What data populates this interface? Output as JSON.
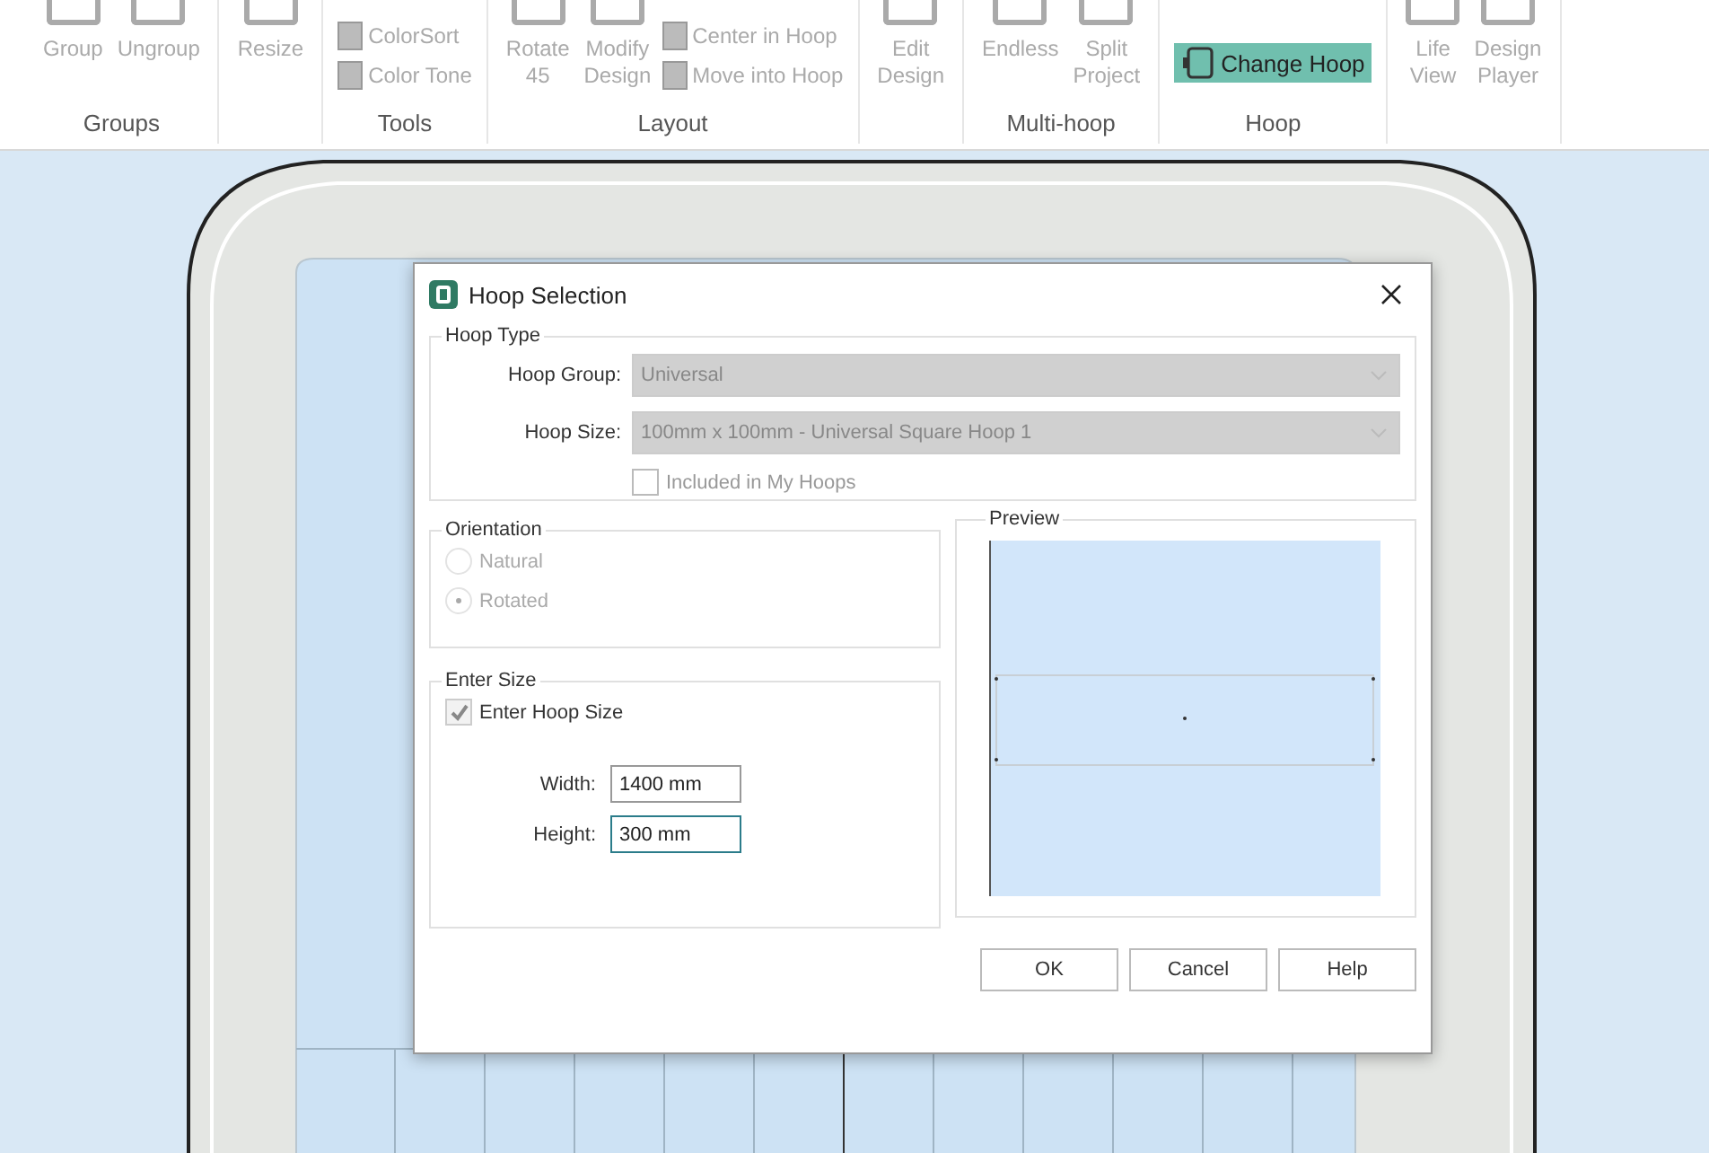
{
  "ribbon": {
    "groups": [
      {
        "label": "Groups",
        "items": [
          {
            "kind": "large",
            "label": "Group",
            "disabled": true,
            "selected": false
          },
          {
            "kind": "large",
            "label": "Ungroup",
            "disabled": true,
            "selected": false
          }
        ]
      },
      {
        "items": [
          {
            "kind": "large",
            "label": "Resize",
            "disabled": true,
            "selected": false
          }
        ]
      },
      {
        "label": "Tools",
        "items": [
          {
            "kind": "stack",
            "buttons": [
              {
                "label": "ColorSort",
                "disabled": true,
                "selected": false
              },
              {
                "label": "Color Tone",
                "disabled": true,
                "selected": false
              }
            ]
          }
        ]
      },
      {
        "label": "Layout",
        "items": [
          {
            "kind": "large",
            "label": "Rotate 45",
            "disabled": true,
            "selected": false
          },
          {
            "kind": "large",
            "label": "Modify Design",
            "disabled": true,
            "selected": false
          },
          {
            "kind": "stack",
            "buttons": [
              {
                "label": "Center in Hoop",
                "disabled": true,
                "selected": false
              },
              {
                "label": "Move into Hoop",
                "disabled": true,
                "selected": false
              }
            ]
          }
        ]
      },
      {
        "items": [
          {
            "kind": "large",
            "label": "Edit Design",
            "disabled": true,
            "selected": false
          }
        ]
      },
      {
        "label": "Multi-hoop",
        "items": [
          {
            "kind": "large",
            "label": "Endless",
            "disabled": true,
            "selected": false
          },
          {
            "kind": "large",
            "label": "Split Project",
            "disabled": true,
            "selected": false
          }
        ]
      },
      {
        "label": "Hoop",
        "items": [
          {
            "kind": "wide",
            "label": "Change Hoop",
            "disabled": false,
            "selected": true
          }
        ]
      },
      {
        "items": [
          {
            "kind": "large",
            "label": "Life View",
            "disabled": true,
            "selected": false
          },
          {
            "kind": "large",
            "label": "Design Player",
            "disabled": true,
            "selected": false
          }
        ]
      }
    ]
  },
  "dialog": {
    "title": "Hoop Selection",
    "hoop_type": {
      "title": "Hoop Type",
      "fields": [
        {
          "label": "Hoop Group:",
          "value": "Universal",
          "disabled": true
        },
        {
          "label": "Hoop Size:",
          "value": "100mm x 100mm - Universal Square Hoop 1",
          "disabled": true
        }
      ],
      "checkbox": {
        "label": "Included in My Hoops",
        "checked": false,
        "disabled": true
      }
    },
    "orientation": {
      "title": "Orientation",
      "options": [
        {
          "label": "Natural",
          "selected": false,
          "disabled": true
        },
        {
          "label": "Rotated",
          "selected": true,
          "disabled": true
        }
      ]
    },
    "enter_size": {
      "title": "Enter Size",
      "checkbox": {
        "label": "Enter Hoop Size",
        "checked": true,
        "disabled": true
      },
      "fields": [
        {
          "label": "Width:",
          "value": "1400 mm",
          "focused": false
        },
        {
          "label": "Height:",
          "value": "300 mm",
          "focused": true
        }
      ]
    },
    "preview": {
      "title": "Preview"
    },
    "buttons": [
      "OK",
      "Cancel",
      "Help"
    ]
  }
}
